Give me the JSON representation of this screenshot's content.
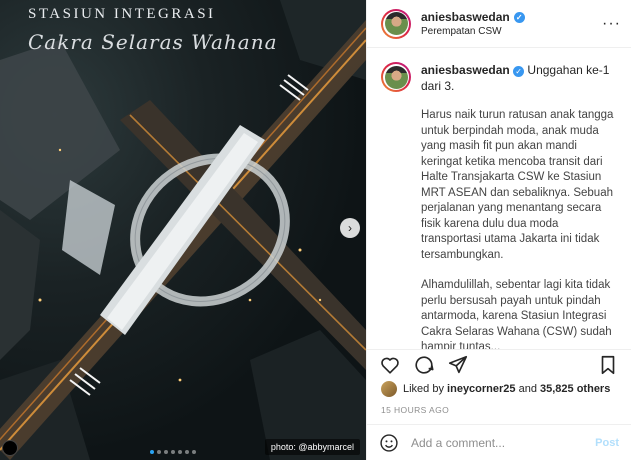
{
  "photo": {
    "title": "STASIUN INTEGRASI",
    "subtitle": "Cakra Selaras Wahana",
    "credit": "photo: @abbymarcel",
    "next_icon": "chevron-right-icon"
  },
  "header": {
    "username": "aniesbaswedan",
    "location": "Perempatan CSW",
    "more_icon": "more-horizontal-icon"
  },
  "caption": {
    "username": "aniesbaswedan",
    "intro": "Unggahan ke-1 dari 3.",
    "paragraph1": "Harus naik turun ratusan anak tangga untuk berpindah moda, anak muda yang masih fit pun akan mandi keringat ketika mencoba transit dari Halte Transjakarta CSW ke Stasiun MRT ASEAN dan sebaliknya. Sebuah perjalanan yang menantang secara fisik karena dulu dua moda transportasi utama Jakarta ini tidak tersambungkan.",
    "paragraph2": "Alhamdulillah, sebentar lagi kita tidak perlu bersusah payah untuk pindah antarmoda, karena Stasiun Integrasi Cakra Selaras Wahana (CSW) sudah hampir tuntas..."
  },
  "actions": {
    "like_icon": "heart-icon",
    "comment_icon": "comment-icon",
    "share_icon": "share-icon",
    "save_icon": "bookmark-icon"
  },
  "likes": {
    "prefix": "Liked by",
    "user": "ineycorner25",
    "middle": "and",
    "count": "35,825 others"
  },
  "timestamp": "15 HOURS AGO",
  "comment_box": {
    "placeholder": "Add a comment...",
    "post_label": "Post",
    "emoji_icon": "emoji-icon"
  },
  "colors": {
    "verified": "#3897f0",
    "post_disabled": "#b2dffc",
    "timestamp": "#8e8e8e"
  }
}
